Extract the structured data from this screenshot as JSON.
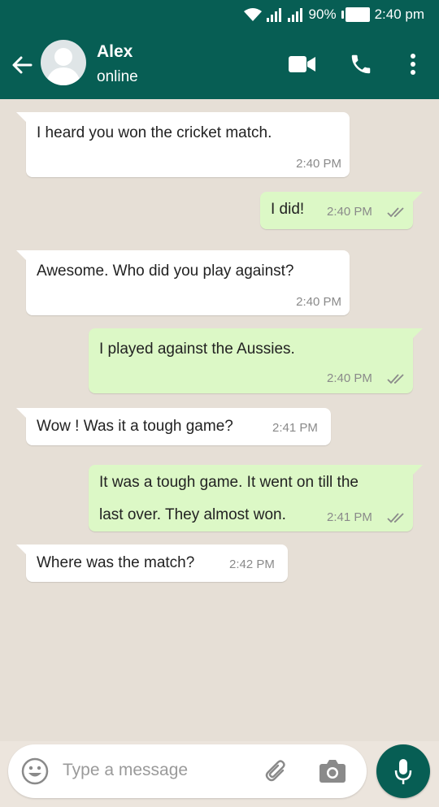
{
  "status_bar": {
    "battery": "90%",
    "time": "2:40 pm"
  },
  "header": {
    "contact_name": "Alex",
    "contact_status": "online"
  },
  "messages": [
    {
      "direction": "in",
      "text": "I heard you won the cricket match.",
      "time": "2:40 PM"
    },
    {
      "direction": "out",
      "text": "I did!",
      "time": "2:40 PM"
    },
    {
      "direction": "in",
      "text": "Awesome. Who did you play against?",
      "time": "2:40 PM"
    },
    {
      "direction": "out",
      "text": "I played against the Aussies.",
      "time": "2:40 PM"
    },
    {
      "direction": "in",
      "text": "Wow ! Was it a tough game?",
      "time": "2:41 PM"
    },
    {
      "direction": "out",
      "text_line1": "It was a tough game. It went on till the",
      "text_line2": "last over. They almost won.",
      "time": "2:41 PM"
    },
    {
      "direction": "in",
      "text": "Where was the match?",
      "time": "2:42 PM"
    }
  ],
  "composer": {
    "placeholder": "Type a message"
  },
  "icons": {
    "back": "arrow-left-icon",
    "video": "video-call-icon",
    "call": "phone-icon",
    "menu": "more-vert-icon",
    "emoji": "emoji-icon",
    "attach": "paperclip-icon",
    "camera": "camera-icon",
    "mic": "microphone-icon",
    "read": "double-check-icon"
  },
  "colors": {
    "header": "#075e54",
    "incoming": "#ffffff",
    "outgoing": "#dcf8c6",
    "background": "#e6dfd6"
  }
}
